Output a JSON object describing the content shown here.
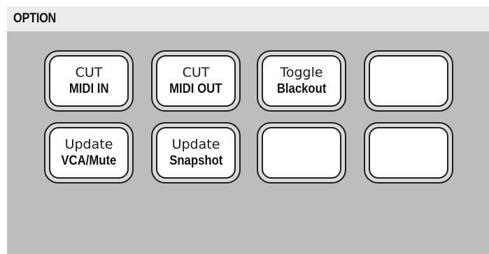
{
  "panel": {
    "title": "OPTION"
  },
  "buttons": [
    {
      "line1": "CUT",
      "line2": "MIDI IN"
    },
    {
      "line1": "CUT",
      "line2": "MIDI OUT"
    },
    {
      "line1": "Toggle",
      "line2": "Blackout"
    },
    {
      "line1": "",
      "line2": ""
    },
    {
      "line1": "Update",
      "line2": "VCA/Mute"
    },
    {
      "line1": "Update",
      "line2": "Snapshot"
    },
    {
      "line1": "",
      "line2": ""
    },
    {
      "line1": "",
      "line2": ""
    }
  ]
}
